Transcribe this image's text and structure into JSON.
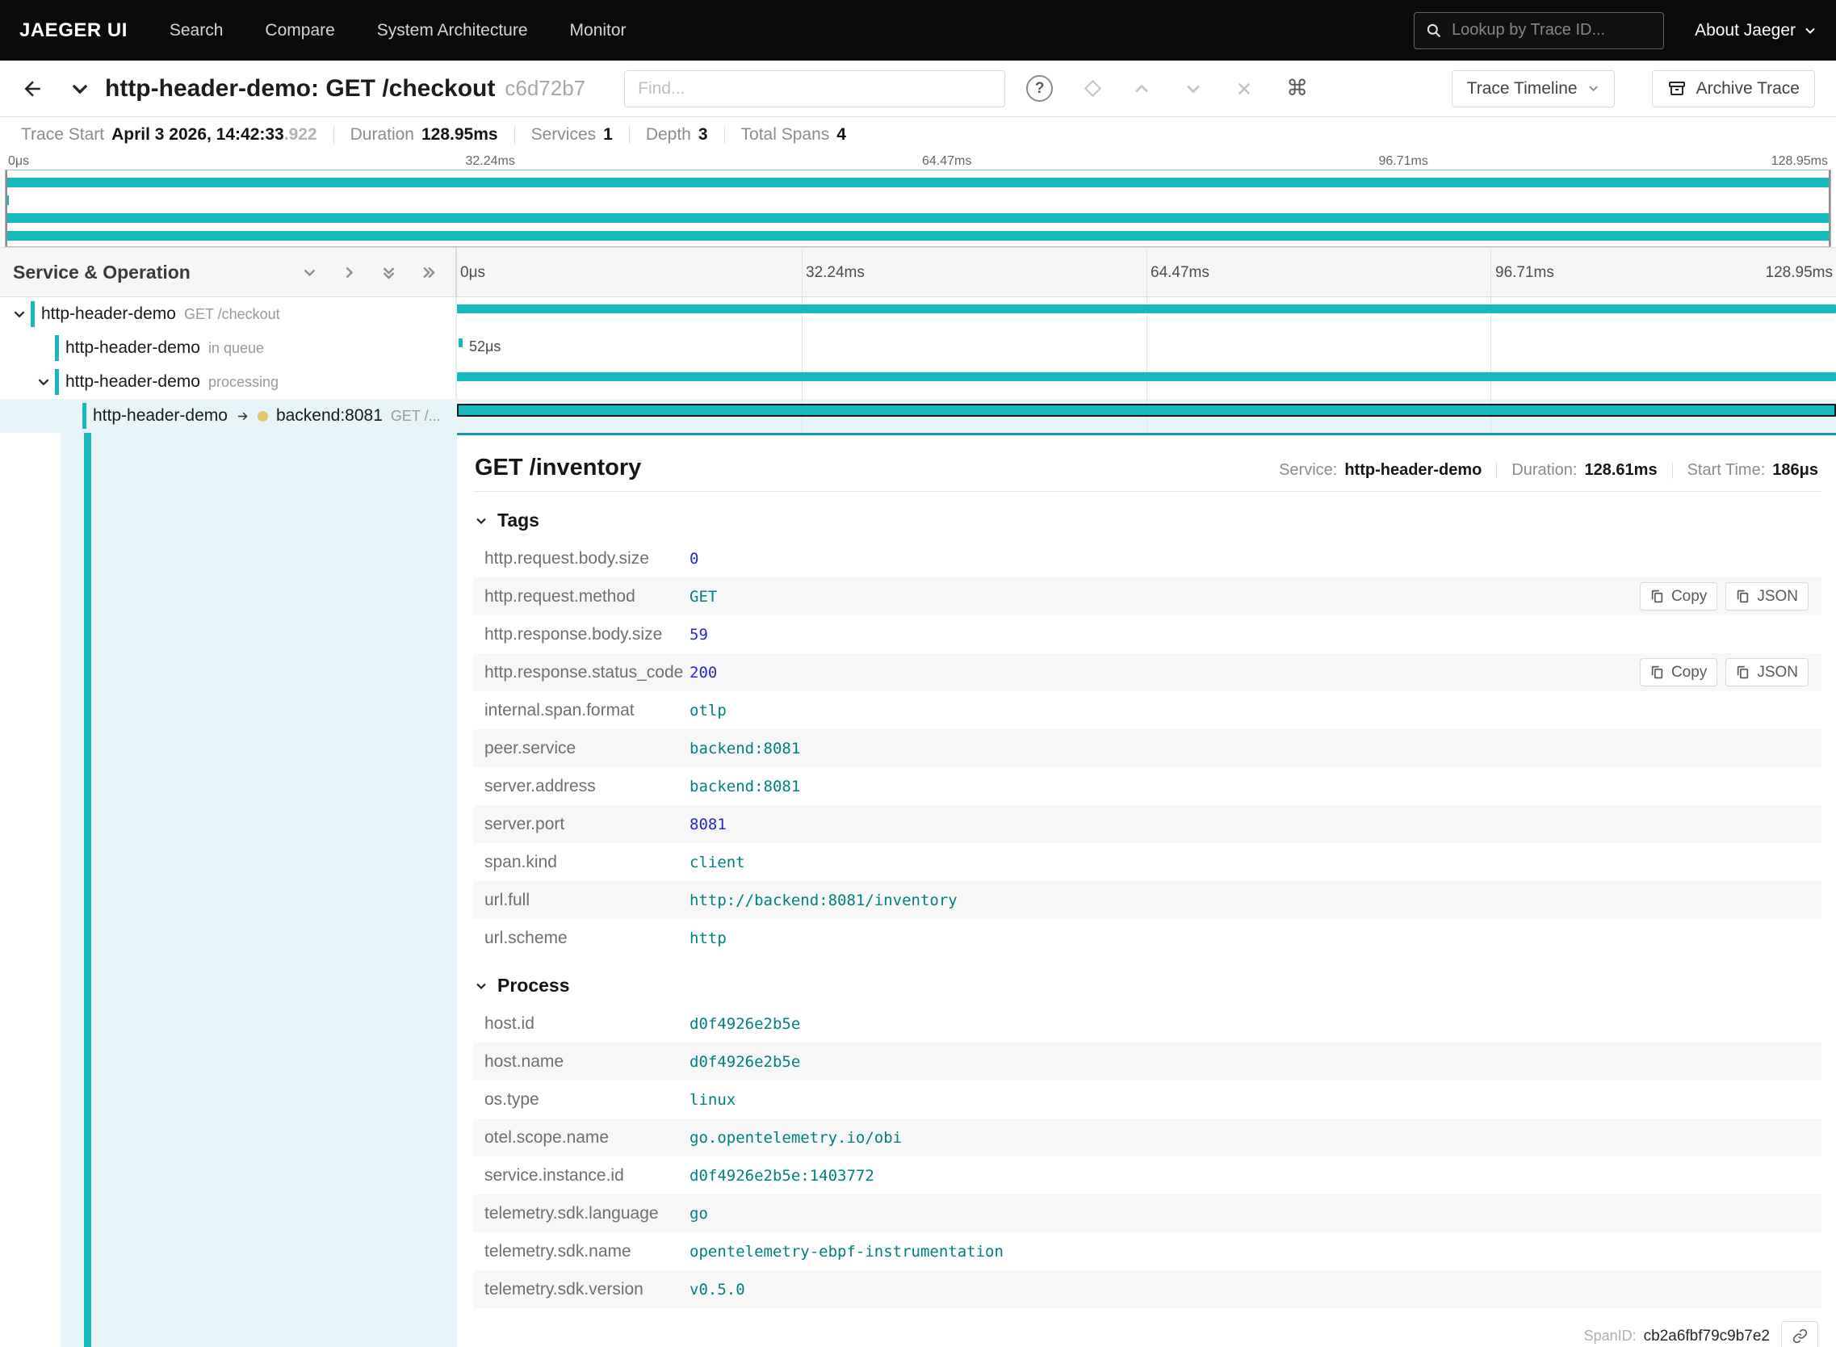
{
  "nav": {
    "brand": "JAEGER UI",
    "items": [
      "Search",
      "Compare",
      "System Architecture",
      "Monitor"
    ],
    "search_placeholder": "Lookup by Trace ID...",
    "about": "About Jaeger"
  },
  "trace_header": {
    "title": "http-header-demo: GET /checkout",
    "trace_id_short": "c6d72b7",
    "find_placeholder": "Find...",
    "help_glyph": "?",
    "cmd_glyph": "⌘",
    "view_select": "Trace Timeline",
    "archive_button": "Archive Trace"
  },
  "summary": {
    "trace_start_label": "Trace Start",
    "trace_start_value": "April 3 2026, 14:42:33",
    "trace_start_ms": ".922",
    "duration_label": "Duration",
    "duration_value": "128.95ms",
    "services_label": "Services",
    "services_value": "1",
    "depth_label": "Depth",
    "depth_value": "3",
    "total_spans_label": "Total Spans",
    "total_spans_value": "4"
  },
  "timeline": {
    "left_header": "Service & Operation",
    "ticks": [
      "0μs",
      "32.24ms",
      "64.47ms",
      "96.71ms",
      "128.95ms"
    ],
    "spans": [
      {
        "service": "http-header-demo",
        "operation": "GET /checkout"
      },
      {
        "service": "http-header-demo",
        "operation": "in queue",
        "duration_label": "52μs"
      },
      {
        "service": "http-header-demo",
        "operation": "processing"
      },
      {
        "service": "http-header-demo",
        "peer": "backend:8081",
        "operation": "GET /..."
      }
    ]
  },
  "detail": {
    "title": "GET /inventory",
    "service_label": "Service:",
    "service": "http-header-demo",
    "duration_label": "Duration:",
    "duration": "128.61ms",
    "start_label": "Start Time:",
    "start": "186μs",
    "tags_title": "Tags",
    "process_title": "Process",
    "copy_label": "Copy",
    "json_label": "JSON",
    "spanid_label": "SpanID:",
    "spanid": "cb2a6fbf79c9b7e2",
    "tags": [
      {
        "key": "http.request.body.size",
        "value": "0"
      },
      {
        "key": "http.request.method",
        "value": "GET"
      },
      {
        "key": "http.response.body.size",
        "value": "59"
      },
      {
        "key": "http.response.status_code",
        "value": "200"
      },
      {
        "key": "internal.span.format",
        "value": "otlp"
      },
      {
        "key": "peer.service",
        "value": "backend:8081"
      },
      {
        "key": "server.address",
        "value": "backend:8081"
      },
      {
        "key": "server.port",
        "value": "8081"
      },
      {
        "key": "span.kind",
        "value": "client"
      },
      {
        "key": "url.full",
        "value": "http://backend:8081/inventory"
      },
      {
        "key": "url.scheme",
        "value": "http"
      }
    ],
    "process": [
      {
        "key": "host.id",
        "value": "d0f4926e2b5e"
      },
      {
        "key": "host.name",
        "value": "d0f4926e2b5e"
      },
      {
        "key": "os.type",
        "value": "linux"
      },
      {
        "key": "otel.scope.name",
        "value": "go.opentelemetry.io/obi"
      },
      {
        "key": "service.instance.id",
        "value": "d0f4926e2b5e:1403772"
      },
      {
        "key": "telemetry.sdk.language",
        "value": "go"
      },
      {
        "key": "telemetry.sdk.name",
        "value": "opentelemetry-ebpf-instrumentation"
      },
      {
        "key": "telemetry.sdk.version",
        "value": "v0.5.0"
      }
    ]
  }
}
